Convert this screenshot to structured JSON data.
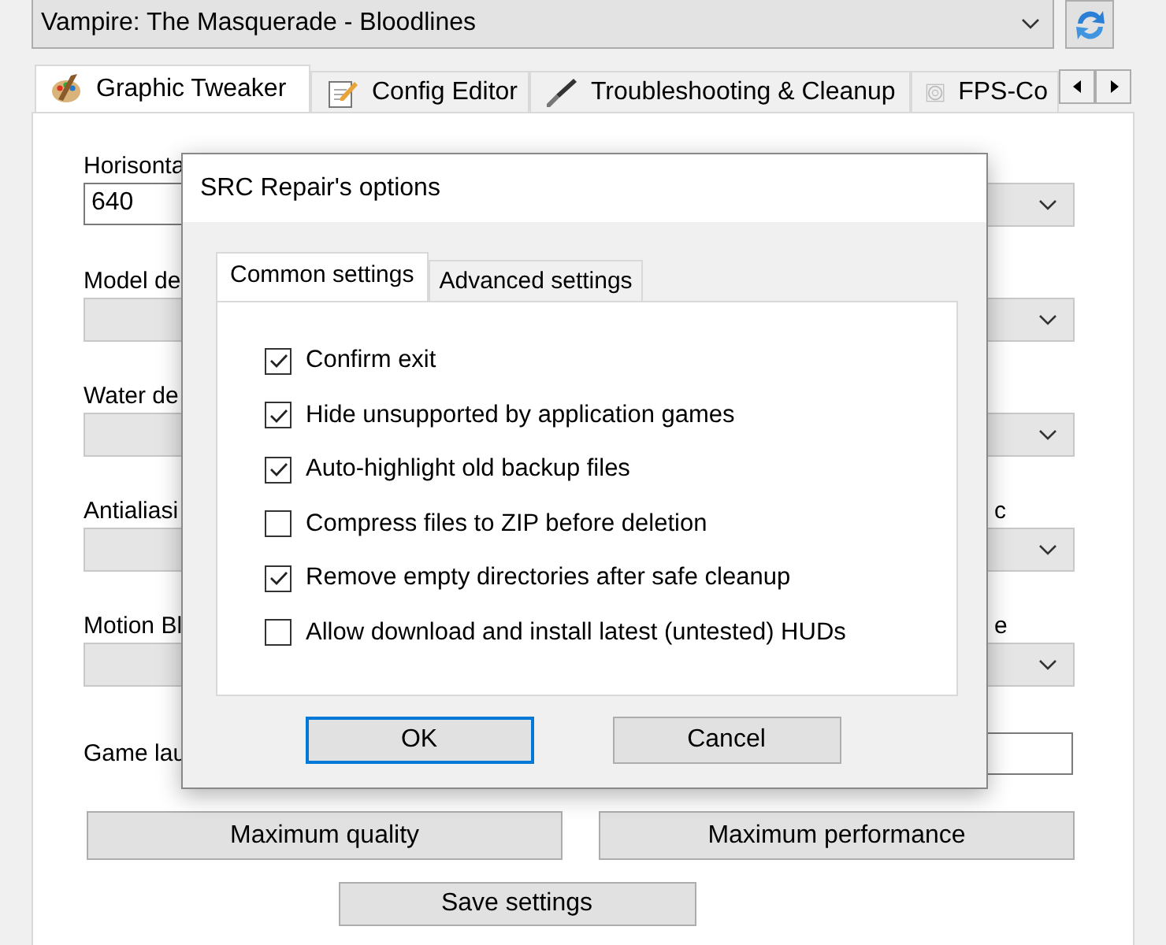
{
  "game_selector": {
    "value": "Vampire: The Masquerade - Bloodlines"
  },
  "tabs": [
    {
      "label": "Graphic Tweaker",
      "selected": true
    },
    {
      "label": "Config Editor",
      "selected": false
    },
    {
      "label": "Troubleshooting & Cleanup",
      "selected": false
    },
    {
      "label": "FPS-Co",
      "selected": false
    }
  ],
  "left_fields": [
    {
      "label": "Horisonta",
      "kind": "text",
      "value": "640"
    },
    {
      "label": "Model de",
      "kind": "combo"
    },
    {
      "label": "Water de",
      "kind": "combo"
    },
    {
      "label": "Antialiasi",
      "kind": "combo"
    },
    {
      "label": "Motion Bl",
      "kind": "combo"
    }
  ],
  "right_fields": [
    {
      "kind": "combo"
    },
    {
      "kind": "combo"
    },
    {
      "kind": "combo"
    },
    {
      "label": "c",
      "kind": "combo"
    },
    {
      "label": "e",
      "kind": "combo"
    }
  ],
  "launch": {
    "label": "Game lau"
  },
  "preset_buttons": [
    "Maximum quality",
    "Maximum performance"
  ],
  "save_button": "Save settings",
  "dialog": {
    "title": "SRC Repair's options",
    "tabs": [
      {
        "label": "Common settings",
        "selected": true
      },
      {
        "label": "Advanced settings",
        "selected": false
      }
    ],
    "options": [
      {
        "label": "Confirm exit",
        "checked": true
      },
      {
        "label": "Hide unsupported by application games",
        "checked": true
      },
      {
        "label": "Auto-highlight old backup files",
        "checked": true
      },
      {
        "label": "Compress files to ZIP before deletion",
        "checked": false
      },
      {
        "label": "Remove empty directories after safe cleanup",
        "checked": true
      },
      {
        "label": "Allow download and install latest (untested) HUDs",
        "checked": false
      }
    ],
    "buttons": [
      {
        "label": "OK",
        "default": true
      },
      {
        "label": "Cancel",
        "default": false
      }
    ]
  }
}
